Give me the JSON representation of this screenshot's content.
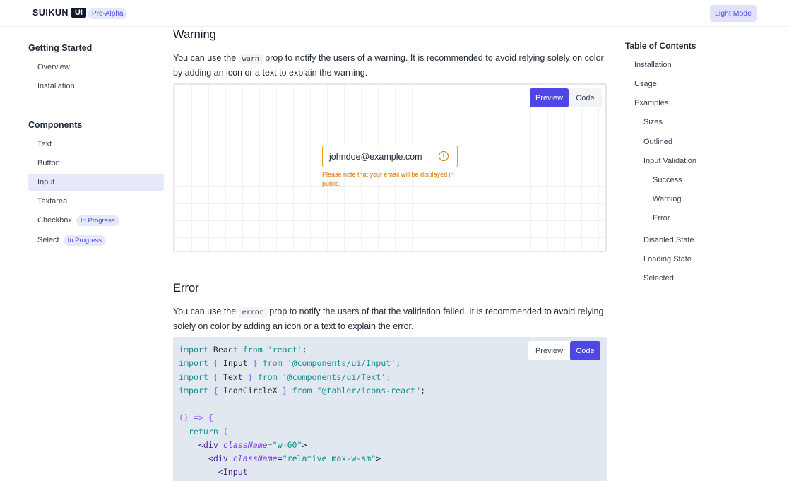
{
  "header": {
    "logo_text": "SUIKUN",
    "logo_badge": "UI",
    "stage_badge": "Pre-Alpha",
    "mode_button": "Light Mode"
  },
  "sidebar": {
    "getting_started": {
      "heading": "Getting Started",
      "items": [
        "Overview",
        "Installation"
      ]
    },
    "components": {
      "heading": "Components",
      "items": [
        {
          "label": "Text"
        },
        {
          "label": "Button"
        },
        {
          "label": "Input",
          "active": true
        },
        {
          "label": "Textarea"
        },
        {
          "label": "Checkbox",
          "badge": "In Progress"
        },
        {
          "label": "Select",
          "badge": "In Progress"
        }
      ]
    }
  },
  "warning_section": {
    "title": "Warning",
    "para_before": "You can use the",
    "code": "warn",
    "para_after": "prop to notify the users of a warning. It is recommended to avoid relying solely on color by adding an icon or a text to explain the warning.",
    "tabs": {
      "preview": "Preview",
      "code": "Code",
      "active": "Preview"
    },
    "input_value": "johndoe@example.com",
    "warn_icon": "!",
    "message": "Please note that your email will be displayed in public.",
    "colors": {
      "border": "#f59e0b",
      "message": "#d97706"
    }
  },
  "error_section": {
    "title": "Error",
    "para_before": "You can use the",
    "code": "error",
    "para_after": "prop to notify the users of that the validation failed. It is recommended to avoid relying solely on color by adding an icon or a text to explain the error.",
    "tabs": {
      "preview": "Preview",
      "code": "Code",
      "active": "Code"
    },
    "code_lines": [
      "import React from 'react';",
      "import { Input } from '@components/ui/Input';",
      "import { Text } from '@components/ui/Text';",
      "import { IconCircleX } from \"@tabler/icons-react\";",
      "",
      "() => {",
      "  return (",
      "    <div className=\"w-60\">",
      "      <div className=\"relative max-w-sm\">",
      "        <Input"
    ]
  },
  "toc": {
    "title": "Table of Contents",
    "items": [
      {
        "label": "Installation",
        "level": 1
      },
      {
        "label": "Usage",
        "level": 1
      },
      {
        "label": "Examples",
        "level": 1
      },
      {
        "label": "Sizes",
        "level": 2
      },
      {
        "label": "Outlined",
        "level": 2
      },
      {
        "label": "Input Validation",
        "level": 2
      },
      {
        "label": "Success",
        "level": 3
      },
      {
        "label": "Warning",
        "level": 3
      },
      {
        "label": "Error",
        "level": 3
      },
      {
        "label": "Disabled State",
        "level": 2
      },
      {
        "label": "Loading State",
        "level": 2
      },
      {
        "label": "Selected",
        "level": 2
      }
    ]
  },
  "theme": {
    "accent": "#4f46e5",
    "accent_soft": "#e6e8fb",
    "code_bg": "#e2e8f0"
  }
}
